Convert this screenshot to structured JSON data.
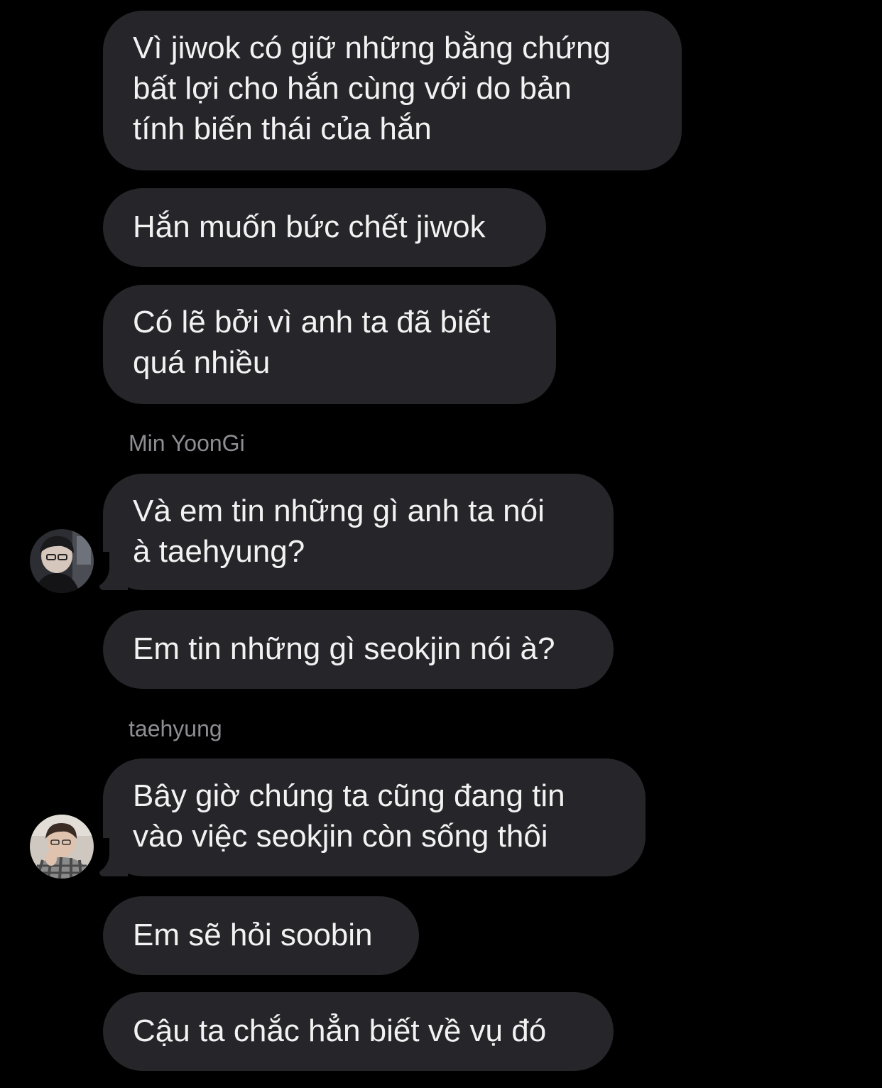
{
  "messages": [
    {
      "text": "Vì jiwok có giữ những bằng chứng\nbất lợi cho hắn cùng với do bản\ntính biến thái của hắn"
    },
    {
      "text": "Hắn muốn bức chết jiwok"
    },
    {
      "text": "Có lẽ bởi vì anh ta đã biết\nquá nhiều"
    },
    {
      "text": "Và em tin những gì anh ta nói\nà taehyung?"
    },
    {
      "text": "Em tin những gì seokjin nói à?"
    },
    {
      "text": "Bây giờ chúng ta cũng đang tin\nvào việc seokjin còn sống thôi"
    },
    {
      "text": "Em sẽ hỏi soobin"
    },
    {
      "text": "Cậu ta chắc hẳn biết về vụ đó"
    }
  ],
  "senders": {
    "yoongi": "Min YoonGi",
    "taehyung": "taehyung"
  },
  "colors": {
    "background": "#000000",
    "bubble": "#26262a",
    "text": "#f2f2f2",
    "sender": "#8d8d93"
  }
}
